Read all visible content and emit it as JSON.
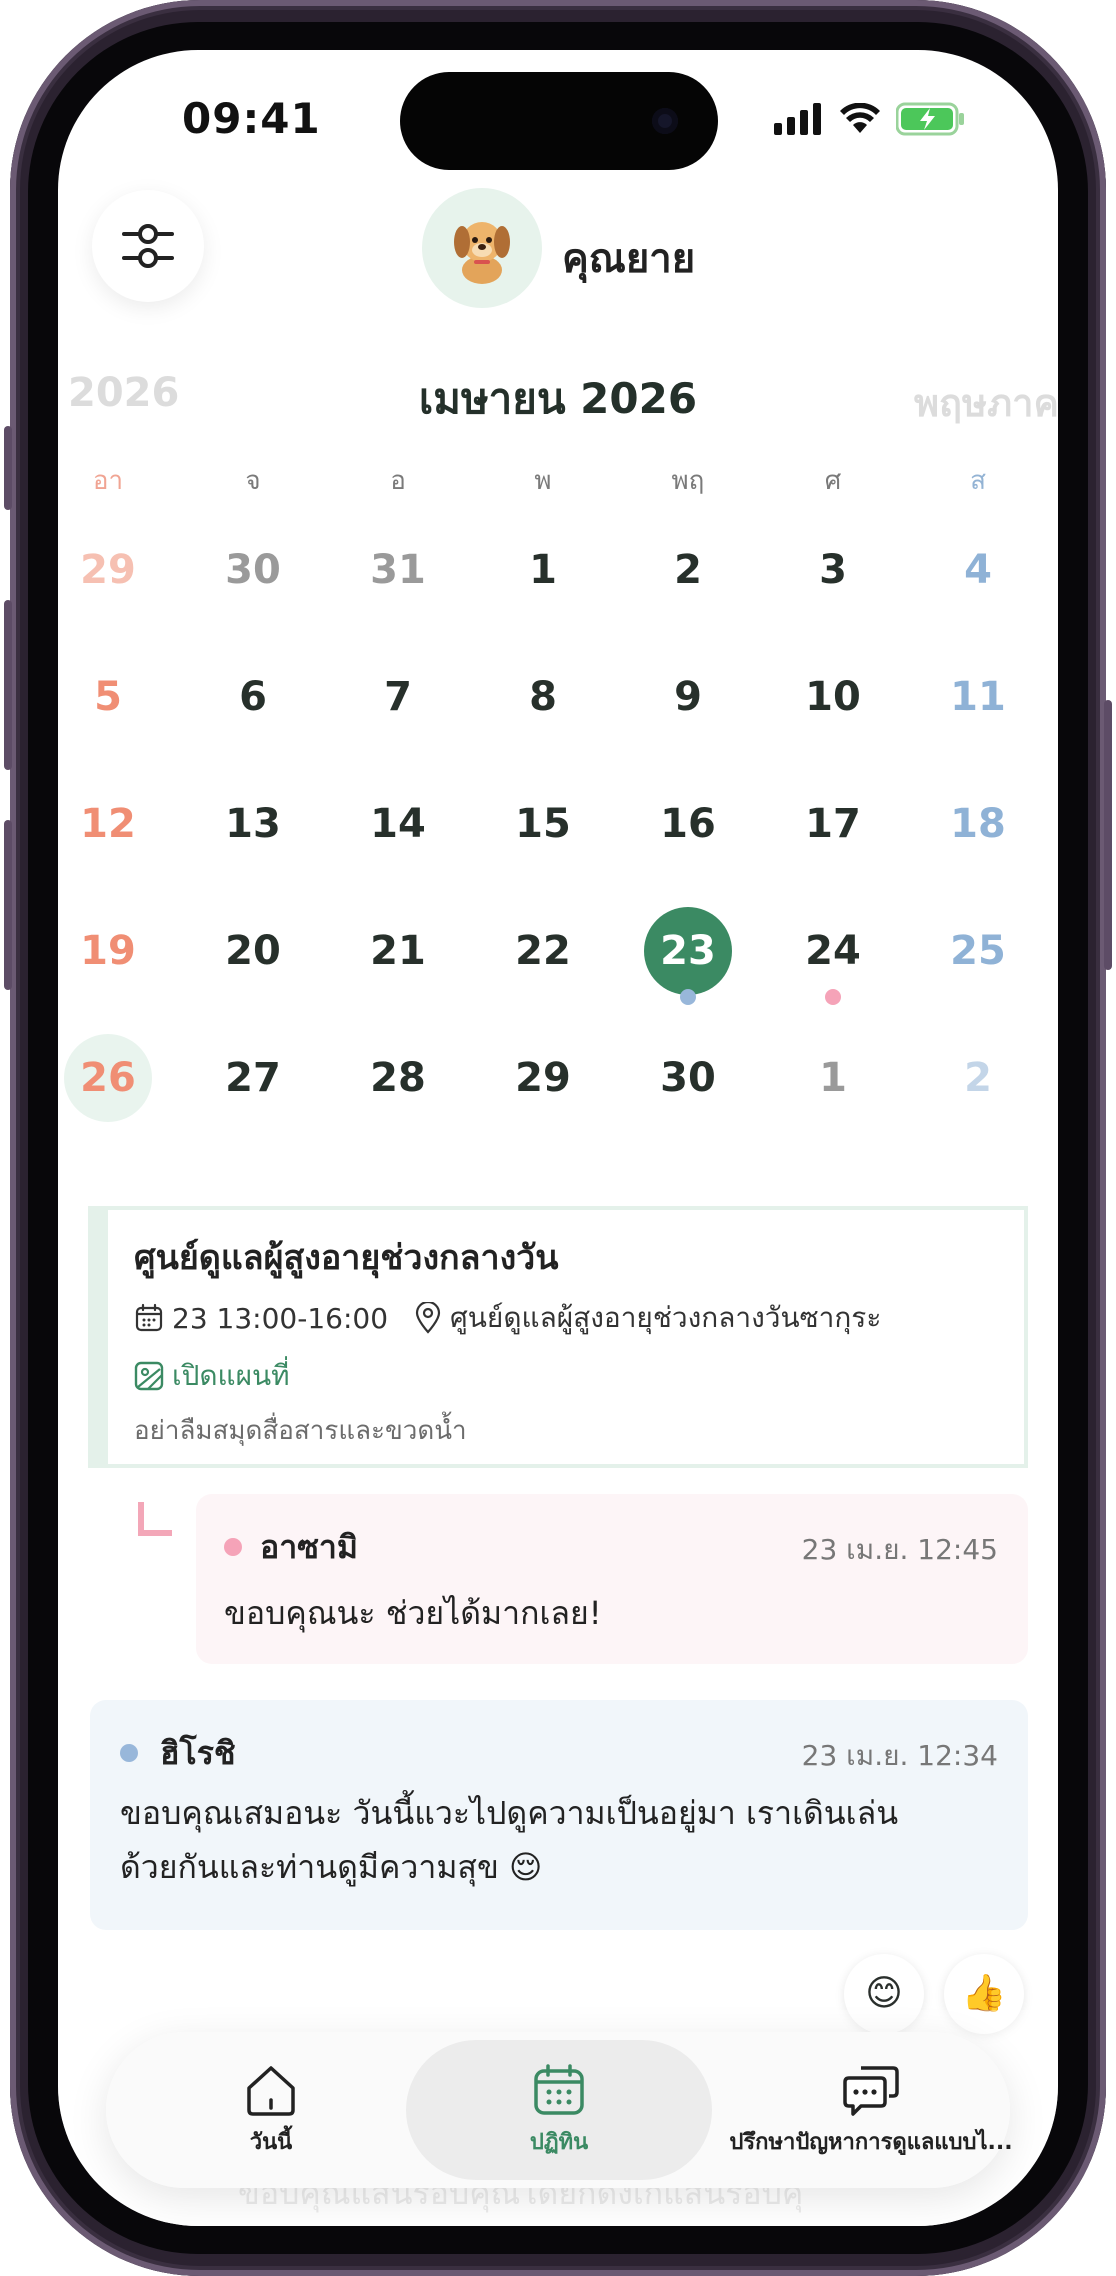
{
  "status_bar": {
    "time": "09:41"
  },
  "header": {
    "profile_name": "คุณยาย"
  },
  "calendar": {
    "prev_month": "2026",
    "current_month": "เมษายน 2026",
    "next_month": "พฤษภาค",
    "weekdays": [
      "อา",
      "จ",
      "อ",
      "พ",
      "พฤ",
      "ศ",
      "ส"
    ],
    "weeks": [
      [
        "29",
        "30",
        "31",
        "1",
        "2",
        "3",
        "4"
      ],
      [
        "5",
        "6",
        "7",
        "8",
        "9",
        "10",
        "11"
      ],
      [
        "12",
        "13",
        "14",
        "15",
        "16",
        "17",
        "18"
      ],
      [
        "19",
        "20",
        "21",
        "22",
        "23",
        "24",
        "25"
      ],
      [
        "26",
        "27",
        "28",
        "29",
        "30",
        "1",
        "2"
      ]
    ],
    "selected_day": "23",
    "today_day": "26",
    "accent_color": "#3b8a63"
  },
  "event": {
    "title": "ศูนย์ดูแลผู้สูงอายุช่วงกลางวัน",
    "time": "23 13:00-16:00",
    "location": "ศูนย์ดูแลผู้สูงอายุช่วงกลางวันซากุระ",
    "map_link": "เปิดแผนที่",
    "note": "อย่าลืมสมุดสื่อสารและขวดน้ำ"
  },
  "comments": [
    {
      "author": "อาซามิ",
      "time": "23 เม.ย. 12:45",
      "text": "ขอบคุณนะ ช่วยได้มากเลย!",
      "dot_color": "#f5a3b8"
    },
    {
      "author": "ฮิโรชิ",
      "time": "23 เม.ย. 12:34",
      "text_line1": "ขอบคุณเสมอนะ วันนี้แวะไปดูความเป็นอยู่มา เราเดินเล่น",
      "text_line2": "ด้วยกันและท่านดูมีความสุข 😌",
      "dot_color": "#98b7da"
    }
  ],
  "reactions": [
    "😊",
    "👍"
  ],
  "background_ghost": "ขอบคุณแสนรอบคุณโดยกดังเกแสนรอบคุ",
  "nav": {
    "home_label": "วันนี้",
    "calendar_label": "ปฏิทิน",
    "chat_label": "ปรึกษาปัญหาการดูแลแบบไ..."
  }
}
